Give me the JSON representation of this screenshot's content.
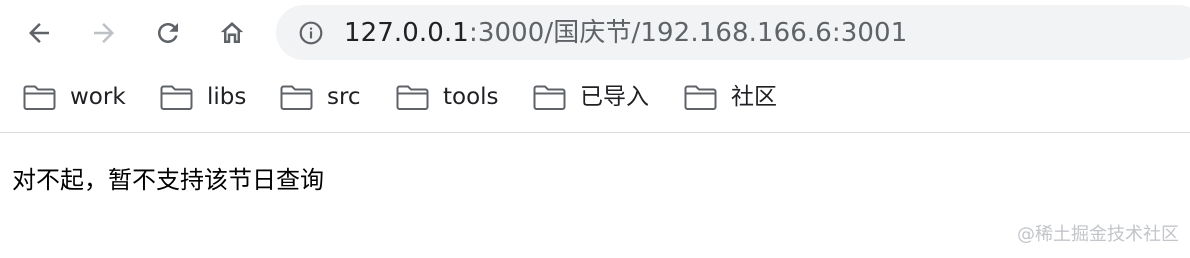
{
  "toolbar": {
    "back_icon": "arrow-left-icon",
    "forward_icon": "arrow-right-icon",
    "reload_icon": "reload-icon",
    "home_icon": "home-icon"
  },
  "omnibox": {
    "info_icon": "info-icon",
    "url_host": "127.0.0.1",
    "url_rest": ":3000/国庆节/192.168.166.6:3001"
  },
  "bookmarks": [
    {
      "label": "work",
      "icon": "folder-icon"
    },
    {
      "label": "libs",
      "icon": "folder-icon"
    },
    {
      "label": "src",
      "icon": "folder-icon"
    },
    {
      "label": "tools",
      "icon": "folder-icon"
    },
    {
      "label": "已导入",
      "icon": "folder-icon"
    },
    {
      "label": "社区",
      "icon": "folder-icon"
    }
  ],
  "page": {
    "message": "对不起，暂不支持该节日查询"
  },
  "watermark": "@稀土掘金技术社区",
  "colors": {
    "omnibox_bg": "#f1f3f4",
    "icon_active": "#5f6368",
    "icon_disabled": "#bdc1c6",
    "divider": "#dadce0"
  }
}
